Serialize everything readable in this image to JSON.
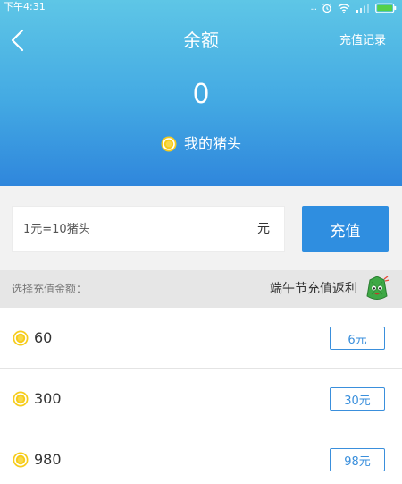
{
  "status_bar": {
    "time": "下午4:31",
    "dots": "...",
    "icons": [
      "alarm-icon",
      "wifi-icon",
      "signal-icon",
      "battery-icon"
    ],
    "battery_color": "#54d04a"
  },
  "nav": {
    "title": "余额",
    "history_link": "充值记录",
    "back_icon": "chevron-left-icon"
  },
  "balance": {
    "value": "0",
    "wallet_label": "我的猪头"
  },
  "recharge": {
    "placeholder": "1元=10猪头",
    "unit": "元",
    "button_label": "充值"
  },
  "section": {
    "label": "选择充值金额：",
    "promo": "端午节充值返利",
    "promo_icon": "zongzi-icon"
  },
  "packages": [
    {
      "amount": "60",
      "price": "6元"
    },
    {
      "amount": "300",
      "price": "30元"
    },
    {
      "amount": "980",
      "price": "98元"
    }
  ],
  "colors": {
    "header_gradient_top": "#5ec6e6",
    "header_gradient_bottom": "#2f86dc",
    "accent": "#2f8ee0",
    "coin": "#f6cc1c"
  }
}
